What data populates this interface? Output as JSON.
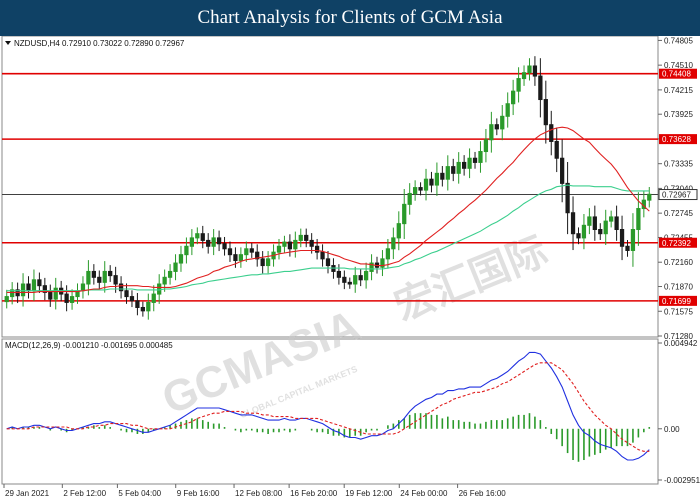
{
  "page_title": "Chart Analysis for Clients of GCM Asia",
  "watermark": {
    "brand": "GCMASIA",
    "cn": "宏汇国际",
    "tagline": "GLOBAL CAPITAL MARKETS"
  },
  "colors": {
    "banner_bg": "#0f4165",
    "bull_candle": "#2a9a2a",
    "bear_candle": "#1a1a1a",
    "ma_fast": "#e02020",
    "ma_slow": "#3ccf8e",
    "resistance_support": "#e00000",
    "current_price_line": "#404040",
    "macd_line": "#2030e0",
    "signal_line": "#e02020",
    "histogram": "#2a9a2a"
  },
  "chart_data": [
    {
      "type": "candlestick",
      "symbol_header": "NZDUSD,H4  0.72910 0.73022 0.72890 0.72967",
      "ylim": [
        0.7128,
        0.7481
      ],
      "y_ticks": [
        "0.74805",
        "0.74510",
        "0.74215",
        "0.73925",
        "0.73630",
        "0.73335",
        "0.73040",
        "0.72745",
        "0.72455",
        "0.72160",
        "0.71870",
        "0.71575",
        "0.71280"
      ],
      "levels": [
        {
          "label": "0.74408",
          "value": 0.74408
        },
        {
          "label": "0.73628",
          "value": 0.73628
        },
        {
          "label": "0.72392",
          "value": 0.72392
        },
        {
          "label": "0.71699",
          "value": 0.71699
        }
      ],
      "current_price": {
        "label": "0.72967",
        "value": 0.72967
      },
      "x_labels": [
        "29 Jan 2021",
        "2 Feb 12:00",
        "5 Feb 04:00",
        "9 Feb 16:00",
        "12 Feb 08:00",
        "16 Feb 20:00",
        "19 Feb 12:00",
        "24 Feb 00:00",
        "26 Feb 16:00"
      ],
      "closes": [
        0.7175,
        0.7183,
        0.7176,
        0.719,
        0.7182,
        0.7195,
        0.7188,
        0.718,
        0.7172,
        0.7185,
        0.7178,
        0.7168,
        0.7175,
        0.7182,
        0.719,
        0.7205,
        0.7198,
        0.7192,
        0.7205,
        0.72,
        0.719,
        0.7182,
        0.7175,
        0.717,
        0.7162,
        0.7158,
        0.7168,
        0.7178,
        0.719,
        0.7198,
        0.7205,
        0.7215,
        0.7225,
        0.7235,
        0.7245,
        0.725,
        0.7242,
        0.7235,
        0.7245,
        0.7238,
        0.7232,
        0.7225,
        0.7218,
        0.7225,
        0.7232,
        0.7228,
        0.722,
        0.7212,
        0.722,
        0.7228,
        0.7235,
        0.724,
        0.7232,
        0.7242,
        0.7248,
        0.7242,
        0.7235,
        0.7228,
        0.722,
        0.7212,
        0.7205,
        0.7198,
        0.7192,
        0.719,
        0.72,
        0.7195,
        0.7205,
        0.7215,
        0.721,
        0.722,
        0.7232,
        0.7245,
        0.7262,
        0.7285,
        0.7298,
        0.7305,
        0.7302,
        0.7315,
        0.7308,
        0.7322,
        0.7315,
        0.733,
        0.7322,
        0.7335,
        0.7328,
        0.734,
        0.7335,
        0.7348,
        0.7362,
        0.738,
        0.7375,
        0.739,
        0.7405,
        0.742,
        0.7435,
        0.7442,
        0.745,
        0.7438,
        0.741,
        0.738,
        0.736,
        0.734,
        0.731,
        0.7275,
        0.725,
        0.7245,
        0.726,
        0.727,
        0.7255,
        0.725,
        0.7265,
        0.727,
        0.7255,
        0.7235,
        0.723,
        0.7255,
        0.728,
        0.729,
        0.7297
      ],
      "ma_fast": [
        0.718,
        0.718,
        0.718,
        0.718,
        0.718,
        0.718,
        0.7181,
        0.7181,
        0.7181,
        0.7181,
        0.7181,
        0.7181,
        0.7181,
        0.7181,
        0.7182,
        0.7183,
        0.7184,
        0.7184,
        0.7186,
        0.7187,
        0.7187,
        0.7188,
        0.7188,
        0.7188,
        0.7188,
        0.7187,
        0.7187,
        0.7186,
        0.7186,
        0.7186,
        0.7186,
        0.7187,
        0.7189,
        0.7191,
        0.7194,
        0.7197,
        0.7199,
        0.7201,
        0.7205,
        0.7207,
        0.721,
        0.7212,
        0.7214,
        0.7217,
        0.7219,
        0.722,
        0.7221,
        0.7222,
        0.7223,
        0.7224,
        0.7226,
        0.7227,
        0.7228,
        0.7229,
        0.723,
        0.723,
        0.723,
        0.723,
        0.7229,
        0.7227,
        0.7225,
        0.7223,
        0.722,
        0.7218,
        0.7216,
        0.7214,
        0.7214,
        0.7213,
        0.7212,
        0.7212,
        0.7213,
        0.7215,
        0.7217,
        0.7222,
        0.7226,
        0.7231,
        0.7236,
        0.7242,
        0.7247,
        0.7252,
        0.7257,
        0.7263,
        0.7268,
        0.7274,
        0.7279,
        0.7285,
        0.729,
        0.7296,
        0.7302,
        0.7309,
        0.7316,
        0.7322,
        0.7329,
        0.7335,
        0.7343,
        0.735,
        0.7357,
        0.7363,
        0.7368,
        0.7371,
        0.7374,
        0.7376,
        0.7377,
        0.7376,
        0.7373,
        0.7368,
        0.7363,
        0.7359,
        0.7352,
        0.7345,
        0.7339,
        0.7333,
        0.7325,
        0.7315,
        0.7305,
        0.7297,
        0.7289,
        0.7283,
        0.7277
      ],
      "ma_slow": [
        0.7182,
        0.7182,
        0.7182,
        0.7182,
        0.7182,
        0.7182,
        0.7182,
        0.7182,
        0.7182,
        0.7182,
        0.7182,
        0.7182,
        0.7182,
        0.7182,
        0.7182,
        0.7183,
        0.7183,
        0.7183,
        0.7183,
        0.7184,
        0.7184,
        0.7184,
        0.7184,
        0.7184,
        0.7183,
        0.7183,
        0.7183,
        0.7183,
        0.7183,
        0.7184,
        0.7184,
        0.7185,
        0.7186,
        0.7187,
        0.7189,
        0.719,
        0.7191,
        0.7193,
        0.7194,
        0.7195,
        0.7196,
        0.7197,
        0.7198,
        0.7199,
        0.72,
        0.7201,
        0.7201,
        0.7202,
        0.7202,
        0.7203,
        0.7204,
        0.7205,
        0.7205,
        0.7206,
        0.7207,
        0.7208,
        0.7209,
        0.7209,
        0.7209,
        0.7209,
        0.7209,
        0.7209,
        0.7209,
        0.7208,
        0.7208,
        0.7208,
        0.7208,
        0.7208,
        0.7208,
        0.7208,
        0.7209,
        0.721,
        0.7211,
        0.7214,
        0.7216,
        0.7219,
        0.7221,
        0.7224,
        0.7227,
        0.7229,
        0.7232,
        0.7235,
        0.7238,
        0.7241,
        0.7244,
        0.7247,
        0.725,
        0.7253,
        0.7257,
        0.7261,
        0.7264,
        0.7268,
        0.7272,
        0.7277,
        0.7281,
        0.7286,
        0.729,
        0.7294,
        0.7298,
        0.7301,
        0.7303,
        0.7306,
        0.7307,
        0.7308,
        0.7307,
        0.7307,
        0.7307,
        0.7307,
        0.7306,
        0.7306,
        0.7306,
        0.7306,
        0.7304,
        0.7302,
        0.7301,
        0.7301,
        0.7301,
        0.7301,
        0.7301
      ]
    },
    {
      "type": "macd",
      "header": "MACD(12,26,9) -0.001210 -0.001695 0.000485",
      "ylim": [
        -0.002951,
        0.004942
      ],
      "y_ticks": [
        {
          "label": "0.004942",
          "value": 0.004942
        },
        {
          "label": "0.00",
          "value": 0
        },
        {
          "label": "-0.002951",
          "value": -0.002951
        }
      ],
      "macd": [
        0,
        0.0001,
        0,
        0.0001,
        0.0001,
        0.0002,
        0.0002,
        0.0001,
        0,
        0.0001,
        0,
        -0.0001,
        -0.0001,
        0,
        0.0001,
        0.0002,
        0.0003,
        0.0003,
        0.0004,
        0.0004,
        0.0003,
        0.0002,
        0.0001,
        0,
        -0.0001,
        -0.0002,
        -0.0002,
        -0.0001,
        0,
        0.0001,
        0.0002,
        0.0004,
        0.0006,
        0.0008,
        0.001,
        0.0012,
        0.0012,
        0.0012,
        0.0012,
        0.0012,
        0.0011,
        0.001,
        0.0009,
        0.0008,
        0.0008,
        0.0008,
        0.0007,
        0.0006,
        0.0005,
        0.0005,
        0.0005,
        0.0006,
        0.0005,
        0.0005,
        0.0006,
        0.0006,
        0.0005,
        0.0004,
        0.0003,
        0.0001,
        -0.0001,
        -0.0002,
        -0.0004,
        -0.0005,
        -0.0005,
        -0.0006,
        -0.0005,
        -0.0004,
        -0.0004,
        -0.0003,
        -0.0001,
        0,
        0.0003,
        0.0006,
        0.001,
        0.0013,
        0.0015,
        0.0017,
        0.0018,
        0.002,
        0.002,
        0.0022,
        0.0022,
        0.0023,
        0.0023,
        0.0024,
        0.0024,
        0.0024,
        0.0026,
        0.0028,
        0.0029,
        0.0031,
        0.0033,
        0.0036,
        0.0039,
        0.0041,
        0.0044,
        0.0044,
        0.0043,
        0.0039,
        0.0035,
        0.003,
        0.0024,
        0.0016,
        0.0008,
        0.0002,
        -0.0002,
        -0.0004,
        -0.0007,
        -0.0009,
        -0.001,
        -0.0011,
        -0.0013,
        -0.0016,
        -0.0018,
        -0.0018,
        -0.0017,
        -0.0015,
        -0.0012
      ],
      "signal": [
        0,
        0,
        0,
        0,
        0,
        0.0001,
        0.0001,
        0.0001,
        0.0001,
        0.0001,
        0.0001,
        0.0001,
        0,
        0,
        0,
        0.0001,
        0.0001,
        0.0002,
        0.0002,
        0.0003,
        0.0003,
        0.0003,
        0.0003,
        0.0002,
        0.0002,
        0.0001,
        0,
        0,
        0,
        0,
        0,
        0.0001,
        0.0002,
        0.0003,
        0.0004,
        0.0006,
        0.0007,
        0.0008,
        0.0009,
        0.0009,
        0.001,
        0.001,
        0.001,
        0.001,
        0.0009,
        0.0009,
        0.0009,
        0.0008,
        0.0008,
        0.0007,
        0.0007,
        0.0007,
        0.0007,
        0.0006,
        0.0006,
        0.0006,
        0.0006,
        0.0006,
        0.0005,
        0.0004,
        0.0003,
        0.0002,
        0.0001,
        0,
        -0.0001,
        -0.0002,
        -0.0003,
        -0.0003,
        -0.0003,
        -0.0003,
        -0.0003,
        -0.0003,
        -0.0002,
        0,
        0.0002,
        0.0004,
        0.0006,
        0.0008,
        0.001,
        0.0012,
        0.0014,
        0.0015,
        0.0017,
        0.0018,
        0.0019,
        0.002,
        0.0021,
        0.0021,
        0.0022,
        0.0023,
        0.0024,
        0.0026,
        0.0027,
        0.0029,
        0.0031,
        0.0033,
        0.0035,
        0.0037,
        0.0038,
        0.0038,
        0.0038,
        0.0036,
        0.0034,
        0.003,
        0.0026,
        0.0021,
        0.0016,
        0.0012,
        0.0008,
        0.0005,
        0.0002,
        0,
        -0.0003,
        -0.0006,
        -0.0008,
        -0.001,
        -0.0012,
        -0.0013,
        -0.0013
      ]
    }
  ]
}
